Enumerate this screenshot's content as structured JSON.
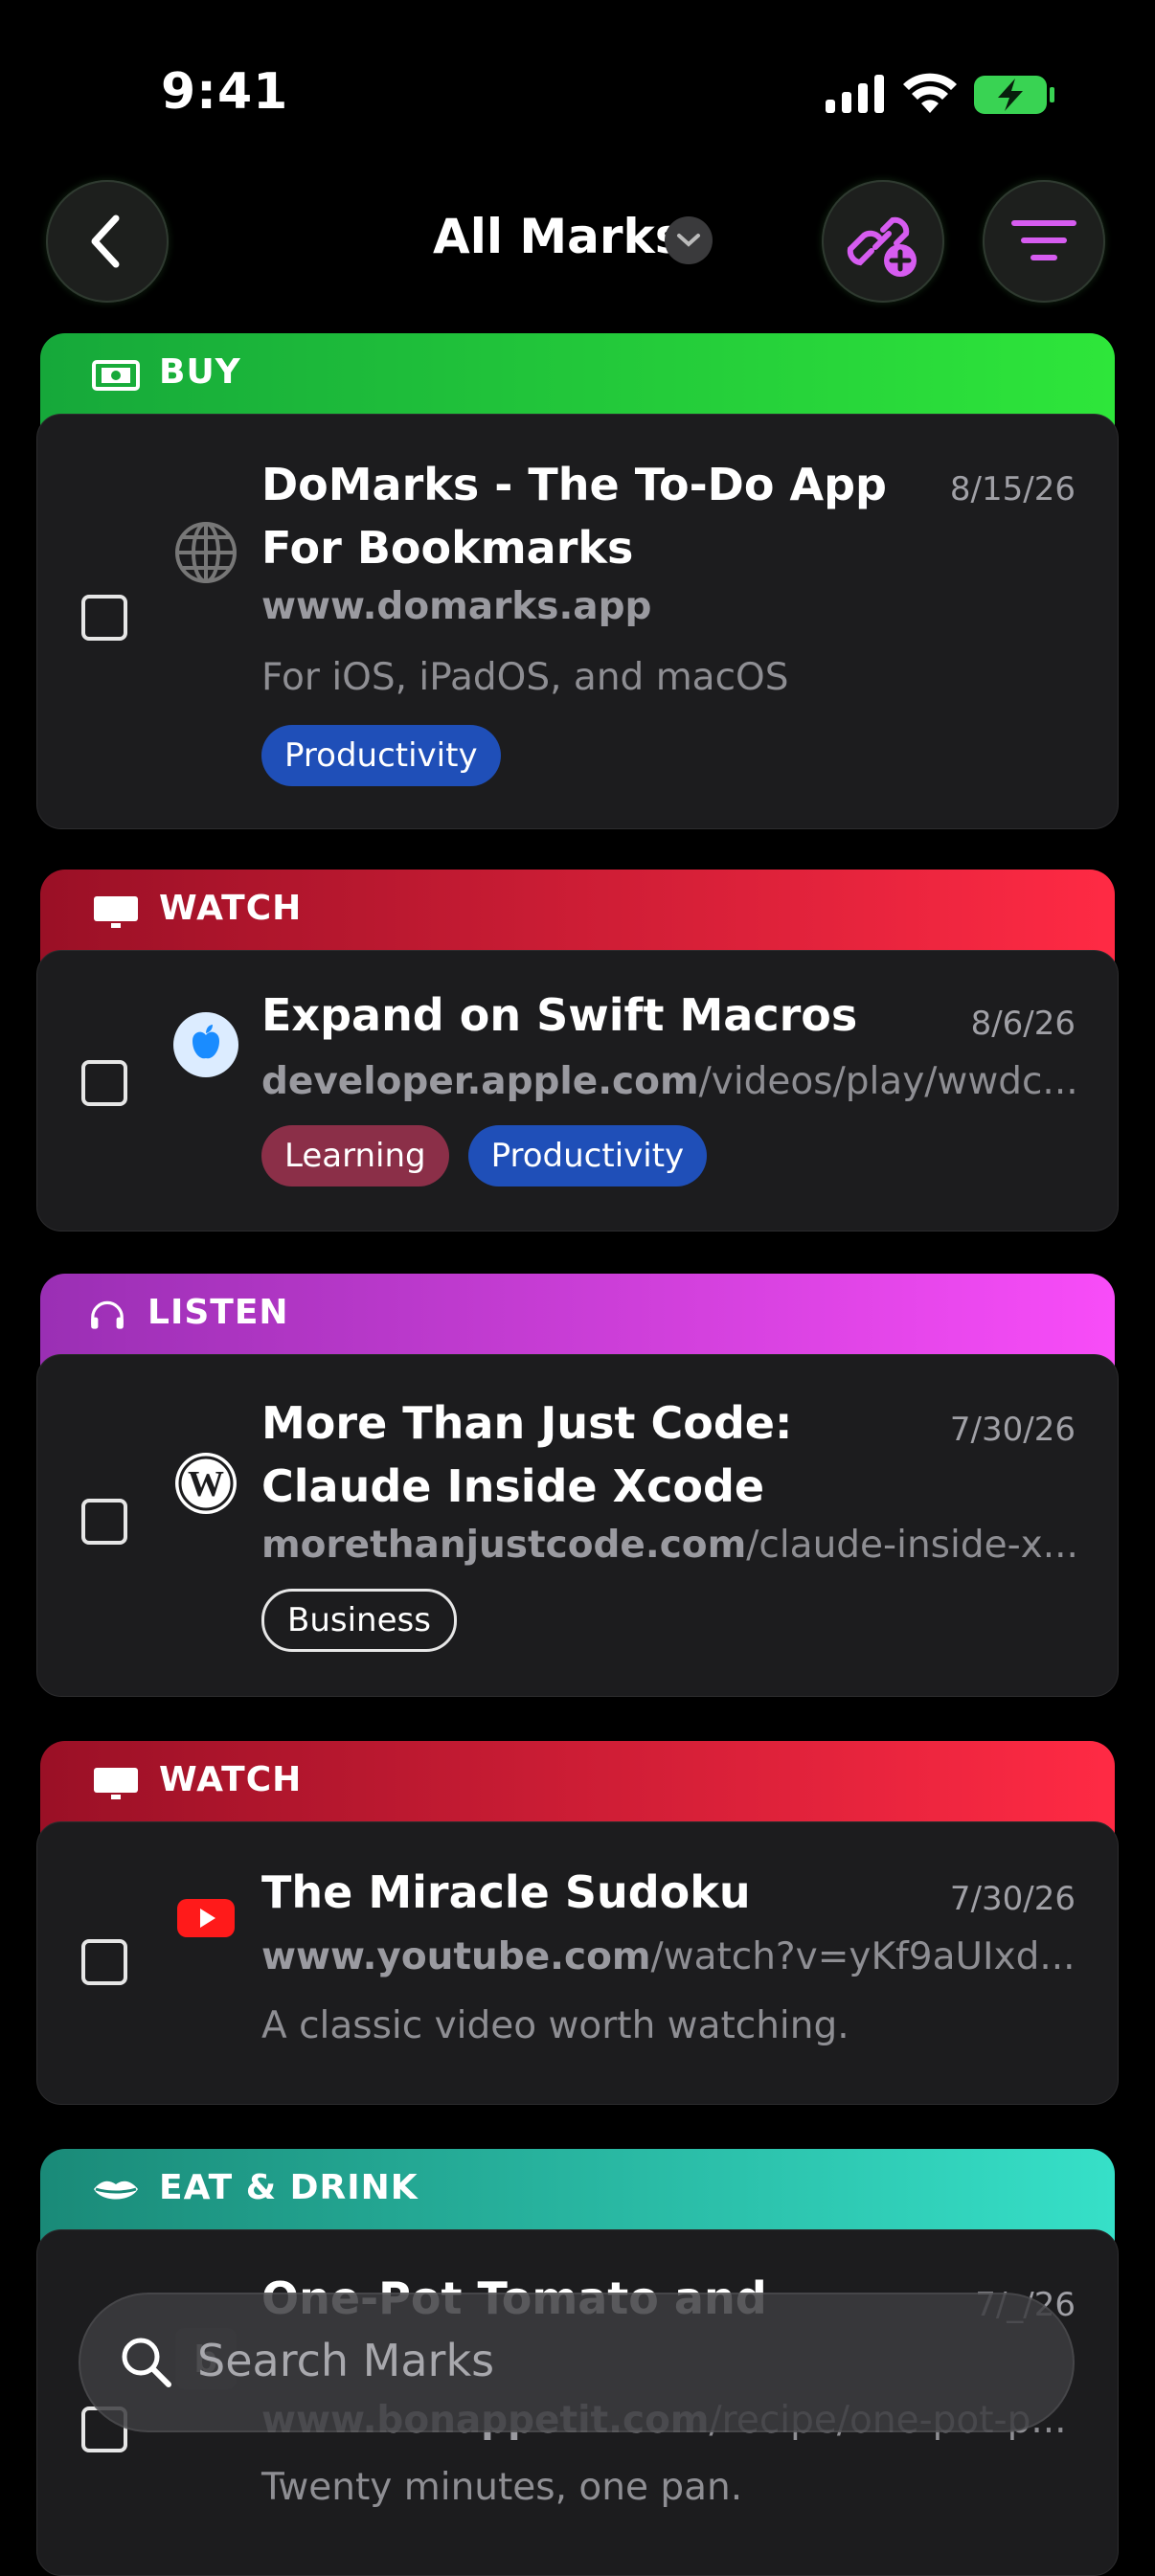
{
  "status": {
    "time": "9:41"
  },
  "nav": {
    "title": "All Marks"
  },
  "colors": {
    "buy": "#2fd42f",
    "watch": "#d8203a",
    "listen": "#c33be0",
    "eat": "#2fb8a0",
    "productivity": "#1f4fb8",
    "learning": "#8b2f48"
  },
  "cards": [
    {
      "category": "BUY",
      "title_line1": "DoMarks - The To-Do App",
      "title_line2": "For Bookmarks",
      "date": "8/15/26",
      "url_domain": "www.domarks.app",
      "url_path": "",
      "description": "For iOS, iPadOS, and macOS",
      "tags": [
        "Productivity"
      ],
      "favicon": "globe-icon"
    },
    {
      "category": "WATCH",
      "title_line1": "Expand on Swift Macros",
      "date": "8/6/26",
      "url_domain": "developer.apple.com",
      "url_path": "/videos/play/wwdc...",
      "tags": [
        "Learning",
        "Productivity"
      ],
      "favicon": "apple-icon"
    },
    {
      "category": "LISTEN",
      "title_line1": "More Than Just Code:",
      "title_line2": "Claude Inside Xcode",
      "date": "7/30/26",
      "url_domain": "morethanjustcode.com",
      "url_path": "/claude-inside-x...",
      "tags": [
        "Business"
      ],
      "favicon": "wordpress-icon"
    },
    {
      "category": "WATCH",
      "title_line1": "The Miracle Sudoku",
      "date": "7/30/26",
      "url_domain": "www.youtube.com",
      "url_path": "/watch?v=yKf9aUIxd...",
      "description": "A classic video worth watching.",
      "favicon": "youtube-icon"
    },
    {
      "category": "EAT & DRINK",
      "title_line1": "One-Pot Tomato and",
      "date": "7/_/26",
      "url_domain": "www.bonappetit.com",
      "url_path": "/recipe/one-pot-p...",
      "description": "Twenty minutes, one pan.",
      "favicon": "bonappetit-icon"
    }
  ],
  "search": {
    "placeholder": "Search Marks"
  }
}
